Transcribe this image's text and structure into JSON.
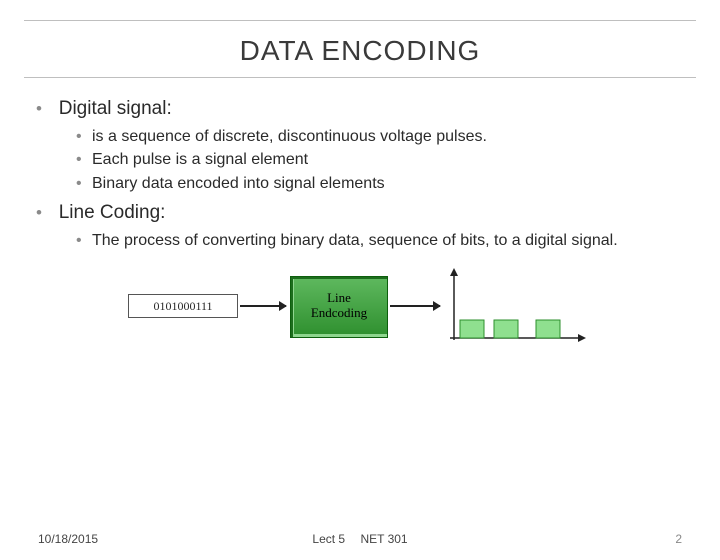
{
  "title": "DATA ENCODING",
  "bullets": {
    "b1": "Digital signal:",
    "b1a": "is a sequence of discrete, discontinuous voltage pulses.",
    "b1b": "Each pulse is a signal element",
    "b1c": "Binary data encoded into signal elements",
    "b2": "Line Coding:",
    "b2a": "The process of converting binary data, sequence of bits, to a digital signal."
  },
  "diagram": {
    "bits": "0101000111",
    "encoder_line1": "Line",
    "encoder_line2": "Endcoding"
  },
  "footer": {
    "date": "10/18/2015",
    "lect": "Lect 5",
    "course": "NET 301",
    "page": "2"
  }
}
